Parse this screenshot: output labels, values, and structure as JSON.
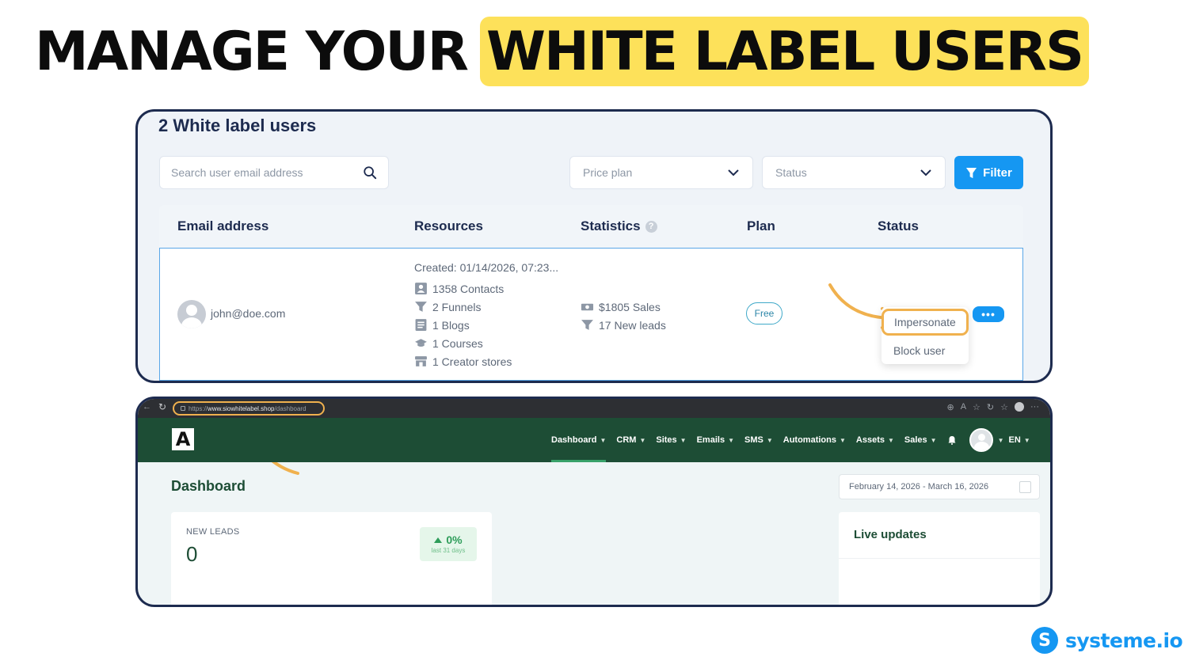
{
  "headline": {
    "plain": "MANAGE YOUR",
    "highlight": "WHITE LABEL USERS",
    "highlight_color": "#fde15a"
  },
  "admin_panel": {
    "title": "2 White label users",
    "search": {
      "placeholder": "Search user email address",
      "icon": "search-icon"
    },
    "price_plan_select": {
      "placeholder": "Price plan",
      "icon": "chevron-down-icon"
    },
    "status_select": {
      "placeholder": "Status",
      "icon": "chevron-down-icon"
    },
    "filter_button": {
      "label": "Filter",
      "icon": "filter-icon",
      "color": "#1597f2"
    },
    "columns": [
      "Email address",
      "Resources",
      "Statistics",
      "Plan",
      "Status"
    ],
    "statistics_info_icon": "info-icon",
    "row": {
      "email": "john@doe.com",
      "created": "Created: 01/14/2026, 07:23...",
      "resources": [
        {
          "icon": "contacts-icon",
          "text": "1358 Contacts"
        },
        {
          "icon": "funnel-icon",
          "text": "2 Funnels"
        },
        {
          "icon": "blog-icon",
          "text": "1 Blogs"
        },
        {
          "icon": "course-icon",
          "text": "1 Courses"
        },
        {
          "icon": "store-icon",
          "text": "1 Creator stores"
        }
      ],
      "statistics": [
        {
          "icon": "money-icon",
          "text": "$1805 Sales"
        },
        {
          "icon": "funnel-icon",
          "text": "17 New leads"
        }
      ],
      "plan": "Free",
      "more_button": "•••",
      "menu": {
        "impersonate": "Impersonate",
        "block": "Block user"
      }
    }
  },
  "browser": {
    "url_prefix": "https://",
    "url_domain": "www.siowhitelabel.shop",
    "url_path": "/dashboard"
  },
  "app": {
    "logo": "A",
    "nav": [
      "Dashboard",
      "CRM",
      "Sites",
      "Emails",
      "SMS",
      "Automations",
      "Assets",
      "Sales"
    ],
    "active_nav": "Dashboard",
    "language": "EN",
    "dashboard_title": "Dashboard",
    "date_range": "February 14, 2026 - March 16, 2026",
    "new_leads": {
      "label": "NEW LEADS",
      "value": "0",
      "change": "0%",
      "period": "last 31 days"
    },
    "live_updates": "Live updates",
    "nav_color": "#1d4d35"
  },
  "brand": {
    "logo_letter": "S",
    "name": "systeme.io",
    "color": "#1597f2"
  }
}
